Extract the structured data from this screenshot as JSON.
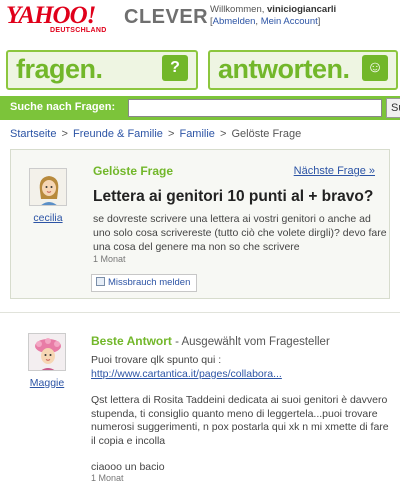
{
  "header": {
    "logo": "YAHOO!",
    "logo_sub": "DEUTSCHLAND",
    "logo_clever": "CLEVER",
    "welcome_prefix": "Willkommen,",
    "username": "viniciogiancarli",
    "links_open": "[",
    "logout": "Abmelden",
    "links_sep": ", ",
    "account": "Mein Account",
    "links_close": "]"
  },
  "nav": {
    "fragen": "fragen.",
    "fragen_badge": "?",
    "antworten": "antworten.",
    "antworten_badge": "☺"
  },
  "search": {
    "label": "Suche nach Fragen:",
    "value": "",
    "button": "Su"
  },
  "breadcrumb": {
    "items": [
      "Startseite",
      "Freunde & Familie",
      "Familie"
    ],
    "current": "Gelöste Frage",
    "sep": ">"
  },
  "question": {
    "heading": "Gelöste Frage",
    "next": "Nächste Frage »",
    "user": "cecilia",
    "title": "Lettera ai genitori 10 punti al + bravo?",
    "text": "se dovreste scrivere una lettera ai vostri genitori o anche ad uno solo cosa scrivereste (tutto ciò che volete dirgli)? devo fare una cosa del genere ma non so che scrivere",
    "time": "1 Monat",
    "report": "Missbrauch melden"
  },
  "answer": {
    "heading": "Beste Antwort",
    "chosen": " - Ausgewählt vom Fragesteller",
    "user": "Maggie",
    "intro": "Puoi trovare qlk spunto qui :",
    "link": "http://www.cartantica.it/pages/collabora...",
    "body": "Qst lettera di Rosita Taddeini dedicata ai suoi genitori è davvero stupenda, ti consiglio quanto meno di leggertela...puoi trovare numerosi suggerimenti, n pox postarla qui xk n mi xmette di fare il copia e incolla",
    "closing": "ciaooo un bacio",
    "time": "1 Monat"
  },
  "colors": {
    "green": "#72b72a",
    "search_bar": "#7cc43a",
    "yahoo_red": "#e0001a",
    "link": "#2c54a5"
  }
}
